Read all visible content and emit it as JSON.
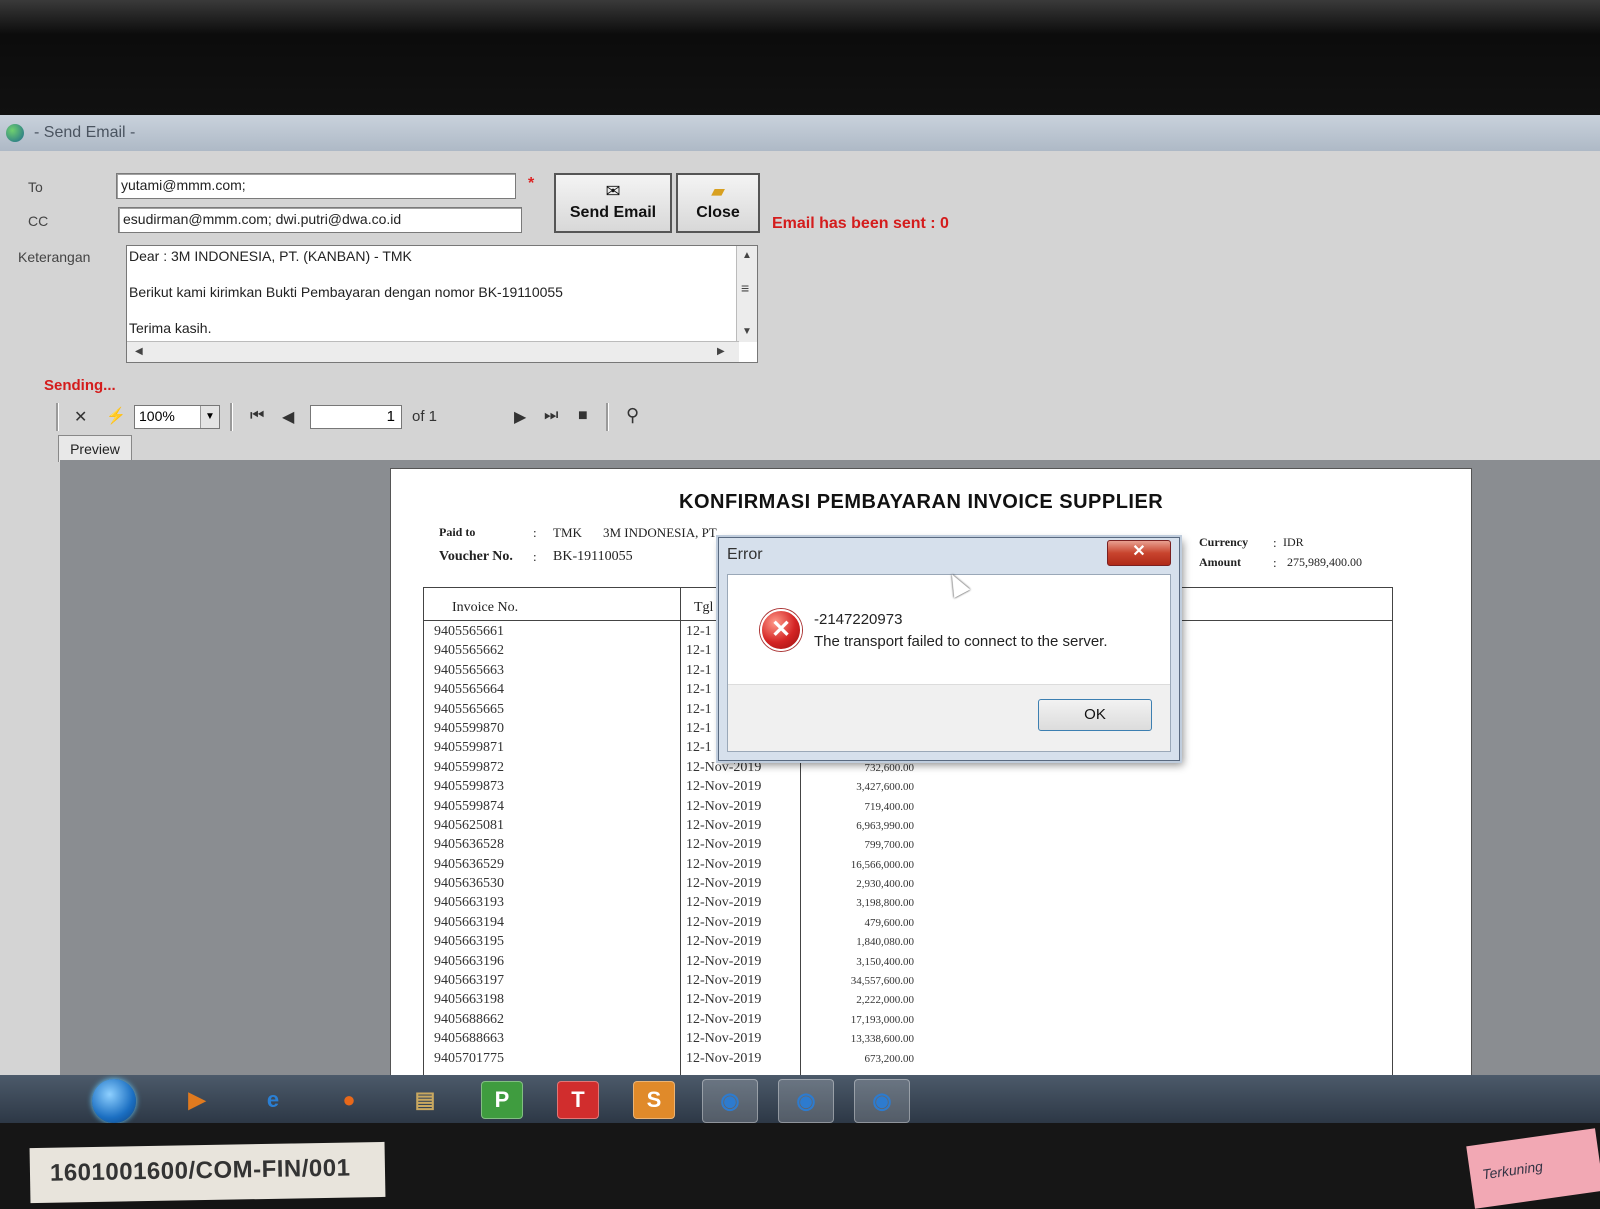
{
  "window": {
    "title": "- Send Email -"
  },
  "form": {
    "to_label": "To",
    "to_value": "yutami@mmm.com;",
    "cc_label": "CC",
    "cc_value": "esudirman@mmm.com; dwi.putri@dwa.co.id",
    "keterangan_label": "Keterangan",
    "body_lines": [
      "Dear : 3M INDONESIA, PT. (KANBAN) - TMK",
      "Berikut kami kirimkan Bukti Pembayaran dengan nomor BK-19110055",
      "Terima kasih."
    ],
    "required_mark": "*"
  },
  "buttons": {
    "send_label": "Send Email",
    "close_label": "Close"
  },
  "status": {
    "email_sent": "Email has been sent : 0",
    "sending": "Sending..."
  },
  "viewer": {
    "zoom": "100%",
    "page": "1",
    "page_of": "of 1",
    "tab": "Preview"
  },
  "report": {
    "title": "KONFIRMASI PEMBAYARAN INVOICE SUPPLIER",
    "paid_to_label": "Paid to",
    "paid_to_code": "TMK",
    "paid_to_name": "3M INDONESIA, PT",
    "voucher_label": "Voucher No.",
    "voucher_value": "BK-19110055",
    "currency_label": "Currency",
    "currency_value": "IDR",
    "amount_label": "Amount",
    "amount_value": "275,989,400.00",
    "colon": ":",
    "col_invoice": "Invoice No.",
    "col_tgl": "Tgl",
    "rows": [
      {
        "inv": "9405565661",
        "tgl": "12-1",
        "amt": ""
      },
      {
        "inv": "9405565662",
        "tgl": "12-1",
        "amt": ""
      },
      {
        "inv": "9405565663",
        "tgl": "12-1",
        "amt": ""
      },
      {
        "inv": "9405565664",
        "tgl": "12-1",
        "amt": ""
      },
      {
        "inv": "9405565665",
        "tgl": "12-1",
        "amt": ""
      },
      {
        "inv": "9405599870",
        "tgl": "12-1",
        "amt": ""
      },
      {
        "inv": "9405599871",
        "tgl": "12-1",
        "amt": ""
      },
      {
        "inv": "9405599872",
        "tgl": "12-Nov-2019",
        "amt": "732,600.00"
      },
      {
        "inv": "9405599873",
        "tgl": "12-Nov-2019",
        "amt": "3,427,600.00"
      },
      {
        "inv": "9405599874",
        "tgl": "12-Nov-2019",
        "amt": "719,400.00"
      },
      {
        "inv": "9405625081",
        "tgl": "12-Nov-2019",
        "amt": "6,963,990.00"
      },
      {
        "inv": "9405636528",
        "tgl": "12-Nov-2019",
        "amt": "799,700.00"
      },
      {
        "inv": "9405636529",
        "tgl": "12-Nov-2019",
        "amt": "16,566,000.00"
      },
      {
        "inv": "9405636530",
        "tgl": "12-Nov-2019",
        "amt": "2,930,400.00"
      },
      {
        "inv": "9405663193",
        "tgl": "12-Nov-2019",
        "amt": "3,198,800.00"
      },
      {
        "inv": "9405663194",
        "tgl": "12-Nov-2019",
        "amt": "479,600.00"
      },
      {
        "inv": "9405663195",
        "tgl": "12-Nov-2019",
        "amt": "1,840,080.00"
      },
      {
        "inv": "9405663196",
        "tgl": "12-Nov-2019",
        "amt": "3,150,400.00"
      },
      {
        "inv": "9405663197",
        "tgl": "12-Nov-2019",
        "amt": "34,557,600.00"
      },
      {
        "inv": "9405663198",
        "tgl": "12-Nov-2019",
        "amt": "2,222,000.00"
      },
      {
        "inv": "9405688662",
        "tgl": "12-Nov-2019",
        "amt": "17,193,000.00"
      },
      {
        "inv": "9405688663",
        "tgl": "12-Nov-2019",
        "amt": "13,338,600.00"
      },
      {
        "inv": "9405701775",
        "tgl": "12-Nov-2019",
        "amt": "673,200.00"
      }
    ]
  },
  "dialog": {
    "title": "Error",
    "close_glyph": "✕",
    "code": "-2147220973",
    "message": "The transport failed to connect to the server.",
    "ok_label": "OK"
  },
  "taskbar": {
    "items": [
      {
        "name": "media-player-icon",
        "glyph": "▶",
        "color": "#e07a1f"
      },
      {
        "name": "internet-explorer-icon",
        "glyph": "e",
        "color": "#2a7fd4"
      },
      {
        "name": "firefox-icon",
        "glyph": "●",
        "color": "#e8681a"
      },
      {
        "name": "folder-icon",
        "glyph": "▤",
        "color": "#c9a860"
      },
      {
        "name": "app-p-icon",
        "glyph": "P",
        "color": "#3f9c3f"
      },
      {
        "name": "app-t-icon",
        "glyph": "T",
        "color": "#d12d2d"
      },
      {
        "name": "app-s-icon",
        "glyph": "S",
        "color": "#e08a2a"
      },
      {
        "name": "globe-app-icon-1",
        "glyph": "◉",
        "color": "#2d7bcf"
      },
      {
        "name": "globe-app-icon-2",
        "glyph": "◉",
        "color": "#2d7bcf"
      },
      {
        "name": "globe-app-icon-3",
        "glyph": "◉",
        "color": "#2d7bcf"
      }
    ]
  },
  "desk": {
    "sticker_label": "1601001600/COM-FIN/001",
    "note_label": "Terkuning"
  }
}
